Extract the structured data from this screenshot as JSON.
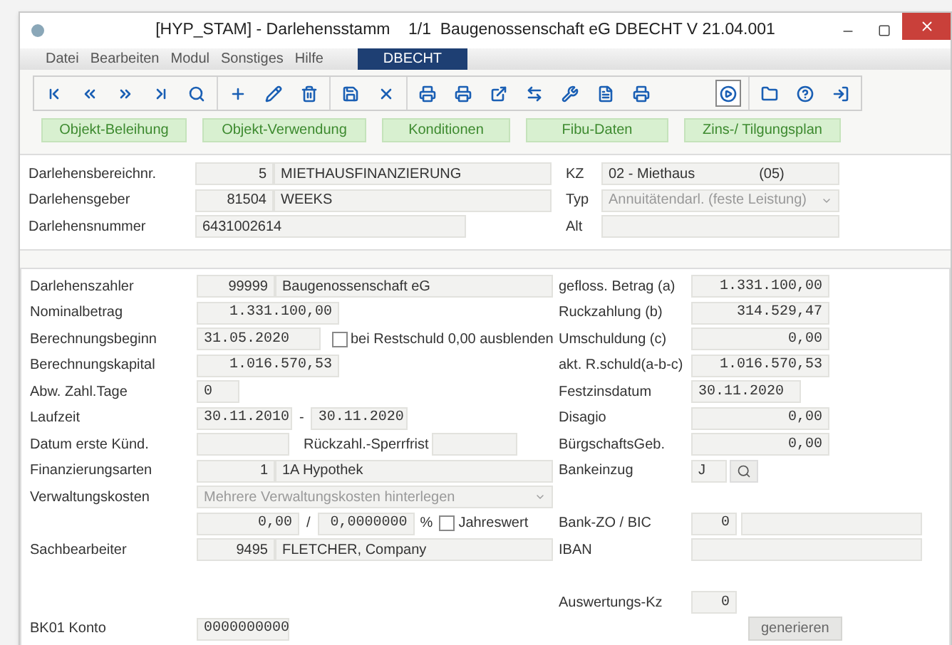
{
  "window": {
    "title": "[HYP_STAM] - Darlehensstamm    1/1  Baugenossenschaft eG DBECHT V 21.04.001"
  },
  "menu": [
    "Datei",
    "Bearbeiten",
    "Modul",
    "Sonstiges",
    "Hilfe"
  ],
  "user_tab": "DBECHT",
  "toolbar": [
    [
      {
        "pressed": false
      },
      {
        "pressed": false
      },
      {
        "pressed": false
      },
      {
        "pressed": false
      },
      {
        "pressed": false
      }
    ],
    [
      {
        "pressed": false
      },
      {
        "pressed": false
      },
      {
        "pressed": false
      }
    ],
    [
      {
        "pressed": false
      },
      {
        "pressed": false
      }
    ],
    [
      {
        "pressed": false
      },
      {
        "pressed": false
      },
      {
        "pressed": false
      },
      {
        "pressed": false
      },
      {
        "pressed": false
      },
      {
        "pressed": false
      },
      {
        "pressed": false
      },
      {
        "pressed": true
      }
    ],
    [
      {
        "pressed": false
      },
      {
        "pressed": false
      },
      {
        "pressed": false
      }
    ]
  ],
  "tabs": [
    "Objekt-Beleihung",
    "Objekt-Verwendung",
    "Konditionen",
    "Fibu-Daten",
    "Zins-/ Tilgungsplan"
  ],
  "header": {
    "left": [
      {
        "kind": "code_name",
        "label": "Darlehensbereichnr.",
        "code": "5",
        "name": "MIETHAUSFINANZIERUNG"
      },
      {
        "kind": "code_name",
        "label": "Darlehensgeber",
        "code": "81504",
        "name": "WEEKS"
      },
      {
        "kind": "single",
        "label": "Darlehensnummer",
        "value": "6431002614"
      }
    ],
    "right": [
      {
        "kind": "text",
        "label": "KZ",
        "value": "02 - Miethaus",
        "extra": "(05)"
      },
      {
        "kind": "select",
        "label": "Typ",
        "value": "Annuitätendarl. (feste Leistung)",
        "disabled": true
      },
      {
        "kind": "text",
        "label": "Alt"
      }
    ]
  },
  "details": {
    "left": [
      {
        "kind": "code_name",
        "label": "Darlehenszahler",
        "code": "99999",
        "name": "Baugenossenschaft eG"
      },
      {
        "kind": "amount",
        "label": "Nominalbetrag",
        "value": "1.331.100,00"
      },
      {
        "kind": "date_check",
        "label": "Berechnungsbeginn",
        "value": "31.05.2020",
        "check_label": "bei Restschuld 0,00 ausblenden",
        "checked": false
      },
      {
        "kind": "amount",
        "label": "Berechnungskapital",
        "value": "1.016.570,53"
      },
      {
        "kind": "small",
        "label": "Abw. Zahl.Tage",
        "value": "0"
      },
      {
        "kind": "range",
        "label": "Laufzeit",
        "from": "30.11.2010",
        "sep": "-",
        "to": "30.11.2020"
      },
      {
        "kind": "date_label",
        "label": "Datum erste Künd.",
        "sub_label": "Rückzahl.-Sperrfrist"
      },
      {
        "kind": "code_name",
        "label": "Finanzierungsarten",
        "code": "1",
        "name": "1A Hypothek"
      },
      {
        "kind": "select",
        "label": "Verwaltungskosten",
        "value": "Mehrere Verwaltungskosten hinterlegen",
        "disabled": true
      },
      {
        "kind": "cost",
        "amount": "0,00",
        "sep": "/",
        "percent": "0,0000000",
        "unit": "%",
        "check_label": "Jahreswert",
        "checked": false
      },
      {
        "kind": "code_name",
        "label": "Sachbearbeiter",
        "code": "9495",
        "name": "FLETCHER, Company"
      },
      {
        "kind": "empty"
      },
      {
        "kind": "empty"
      },
      {
        "kind": "account",
        "label": "BK01 Konto",
        "value": "0000000000"
      }
    ],
    "right": [
      {
        "kind": "amount",
        "label": "gefloss. Betrag (a)",
        "value": "1.331.100,00"
      },
      {
        "kind": "amount",
        "label": "Ruckzahlung (b)",
        "value": "314.529,47"
      },
      {
        "kind": "amount",
        "label": "Umschuldung (c)",
        "value": "0,00"
      },
      {
        "kind": "amount",
        "label": "akt. R.schuld(a-b-c)",
        "value": "1.016.570,53"
      },
      {
        "kind": "date",
        "label": "Festzinsdatum",
        "value": "30.11.2020"
      },
      {
        "kind": "amount",
        "label": "Disagio",
        "value": "0,00"
      },
      {
        "kind": "amount",
        "label": "BürgschaftsGeb.",
        "value": "0,00"
      },
      {
        "kind": "lookup",
        "label": "Bankeinzug",
        "value": "J"
      },
      {
        "kind": "empty"
      },
      {
        "kind": "bank",
        "label": "Bank-ZO / BIC",
        "code": "0"
      },
      {
        "kind": "wide",
        "label": "IBAN"
      },
      {
        "kind": "empty"
      },
      {
        "kind": "small",
        "label": "Auswertungs-Kz",
        "value": "0"
      },
      {
        "kind": "button",
        "label": "generieren"
      }
    ]
  }
}
